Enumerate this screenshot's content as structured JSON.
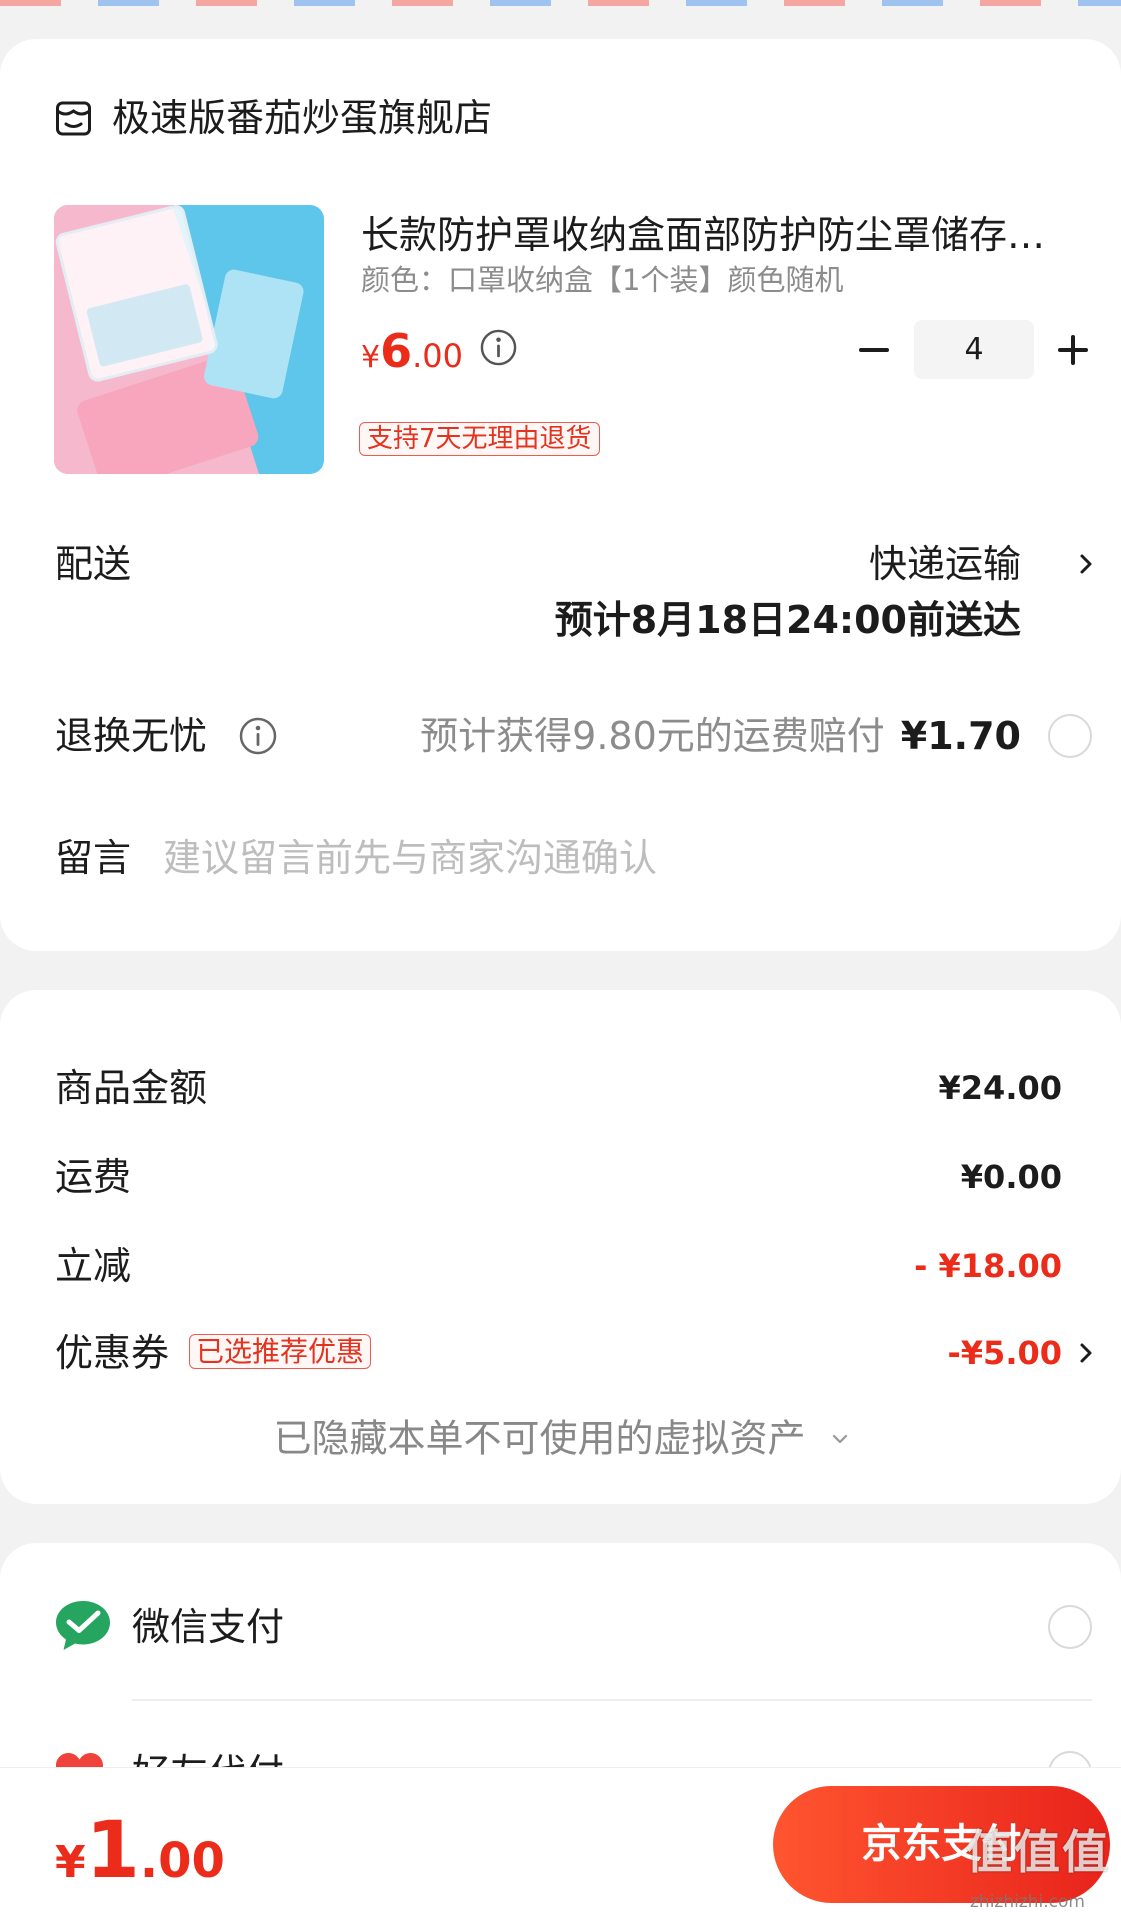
{
  "colors": {
    "accent": "#ec2c1a",
    "text": "#1c1c1c",
    "muted": "#8c8c8c",
    "page_bg": "#f2f2f2",
    "wechat_green": "#25a55f",
    "stripe_red": "#f4a6a0",
    "stripe_blue": "#9ec3ee"
  },
  "store": {
    "icon": "store-icon",
    "name": "极速版番茄炒蛋旗舰店"
  },
  "product": {
    "title": "长款防护罩收纳盒面部防护防尘罩储存…",
    "spec": "颜色：口罩收纳盒【1个装】颜色随机",
    "price": {
      "currency": "¥",
      "integer": "6",
      "decimal": ".00"
    },
    "info_icon": "info-icon",
    "quantity": "4",
    "badge": "支持7天无理由退货"
  },
  "delivery": {
    "label": "配送",
    "method": "快递运输",
    "eta": "预计8月18日24:00前送达",
    "arrow_icon": "chevron-right-icon"
  },
  "return_insurance": {
    "label": "退换无忧",
    "info_icon": "info-icon",
    "description": "预计获得9.80元的运费赔付",
    "price": "¥1.70",
    "selected": false
  },
  "note": {
    "label": "留言",
    "placeholder": "建议留言前先与商家沟通确认"
  },
  "summary": {
    "rows": [
      {
        "label": "商品金额",
        "value": "¥24.00"
      },
      {
        "label": "运费",
        "value": "¥0.00"
      },
      {
        "label": "立减",
        "value": "- ¥18.00"
      },
      {
        "label": "优惠券",
        "badge": "已选推荐优惠",
        "value": "-¥5.00"
      }
    ],
    "hidden_assets": "已隐藏本单不可使用的虚拟资产"
  },
  "payment": {
    "methods": [
      {
        "name": "微信支付",
        "icon": "wechat-pay-icon",
        "selected": false
      },
      {
        "name": "好友代付",
        "icon": "heart-icon",
        "selected": false
      }
    ]
  },
  "footer": {
    "total": {
      "currency": "¥",
      "integer": "1",
      "decimal": ".00"
    },
    "pay_button": "京东支付"
  },
  "watermark": {
    "logo": "值值值",
    "site": "zhizhizhi.com"
  }
}
